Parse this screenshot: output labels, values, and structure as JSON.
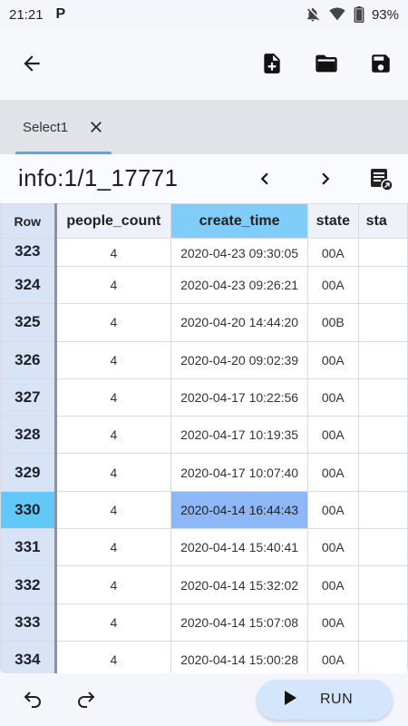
{
  "status_bar": {
    "time": "21:21",
    "app_badge": "P",
    "battery": "93%"
  },
  "app_bar": {
    "icons": [
      "arrow-back-icon",
      "new-file-icon",
      "folder-open-icon",
      "save-icon"
    ]
  },
  "tab": {
    "label": "Select1"
  },
  "panel": {
    "title": "info:1/1_17771"
  },
  "table": {
    "columns": [
      "Row",
      "people_count",
      "create_time",
      "state",
      "sta"
    ],
    "rows": [
      {
        "row": "323",
        "people_count": "4",
        "create_time": "2020-04-23 09:30:05",
        "state": "00A"
      },
      {
        "row": "324",
        "people_count": "4",
        "create_time": "2020-04-23 09:26:21",
        "state": "00A"
      },
      {
        "row": "325",
        "people_count": "4",
        "create_time": "2020-04-20 14:44:20",
        "state": "00B"
      },
      {
        "row": "326",
        "people_count": "4",
        "create_time": "2020-04-20 09:02:39",
        "state": "00A"
      },
      {
        "row": "327",
        "people_count": "4",
        "create_time": "2020-04-17 10:22:56",
        "state": "00A"
      },
      {
        "row": "328",
        "people_count": "4",
        "create_time": "2020-04-17 10:19:35",
        "state": "00A"
      },
      {
        "row": "329",
        "people_count": "4",
        "create_time": "2020-04-17 10:07:40",
        "state": "00A"
      },
      {
        "row": "330",
        "people_count": "4",
        "create_time": "2020-04-14 16:44:43",
        "state": "00A"
      },
      {
        "row": "331",
        "people_count": "4",
        "create_time": "2020-04-14 15:40:41",
        "state": "00A"
      },
      {
        "row": "332",
        "people_count": "4",
        "create_time": "2020-04-14 15:32:02",
        "state": "00A"
      },
      {
        "row": "333",
        "people_count": "4",
        "create_time": "2020-04-14 15:07:08",
        "state": "00A"
      },
      {
        "row": "334",
        "people_count": "4",
        "create_time": "2020-04-14 15:00:28",
        "state": "00A"
      }
    ],
    "selected_row": "330",
    "selected_column": "create_time"
  },
  "bottom_bar": {
    "run_label": "RUN"
  },
  "colors": {
    "accent": "#5aa6ee",
    "selected_header": "#7fcdf8",
    "selected_cell": "#8db7f7",
    "selected_rownum": "#62c8f7",
    "run_button": "#d3e6fb"
  }
}
